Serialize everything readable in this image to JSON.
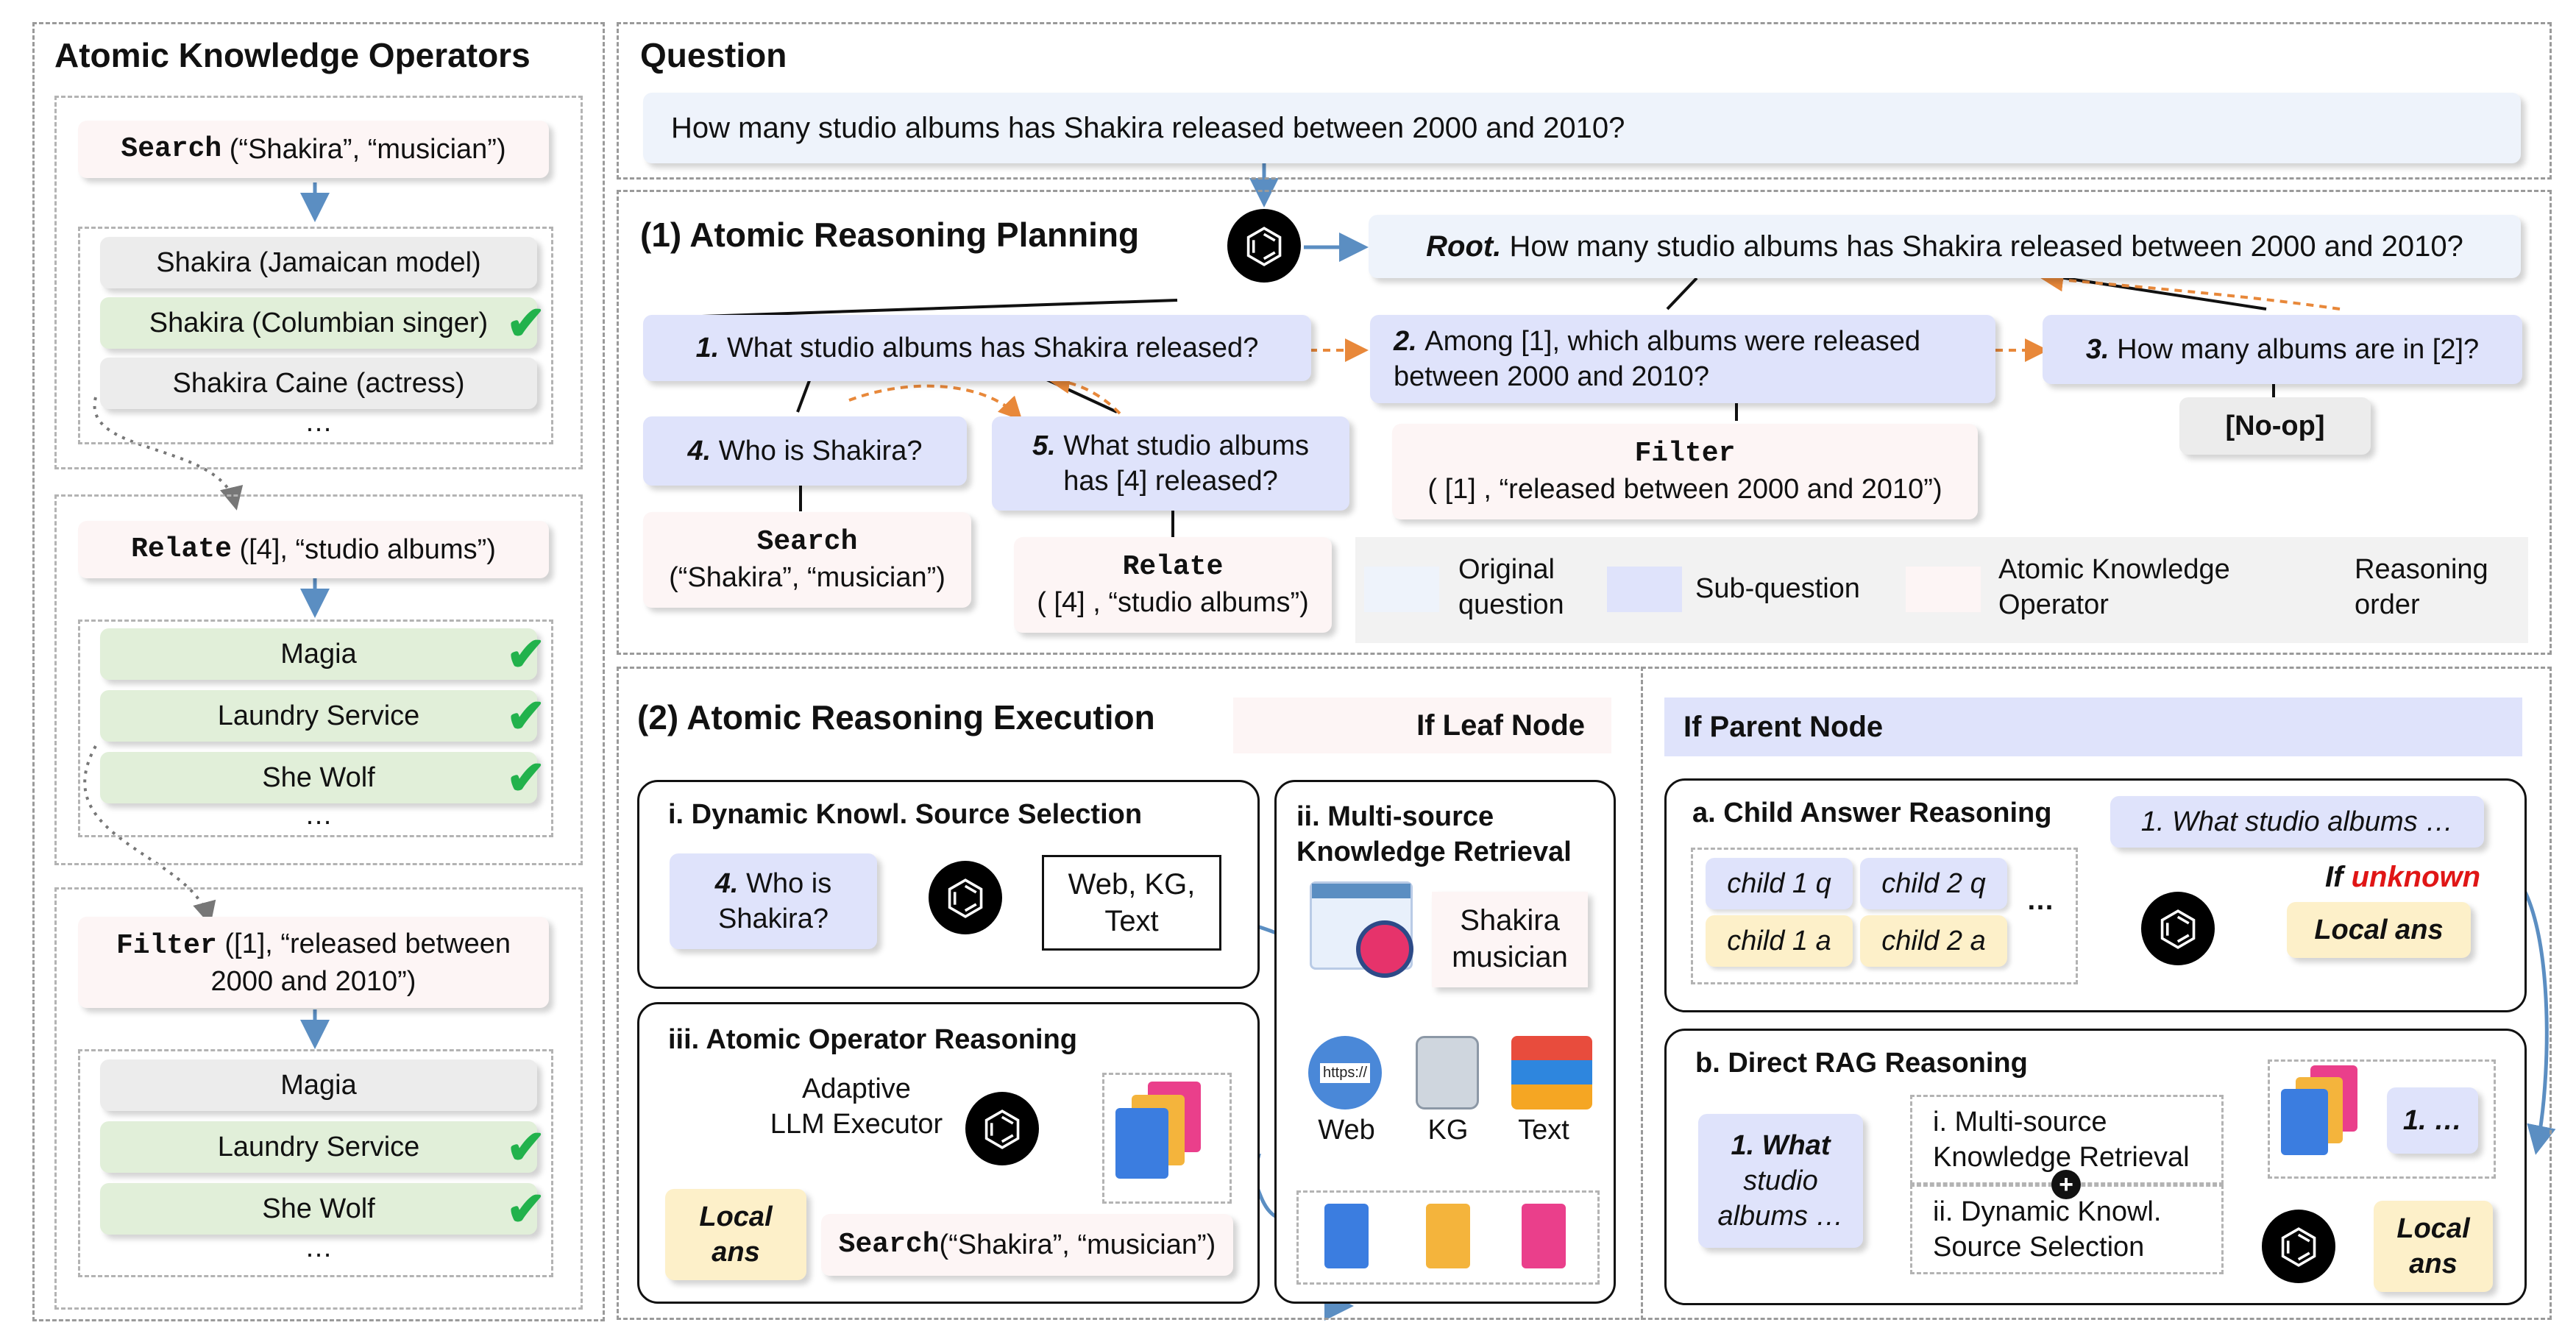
{
  "left": {
    "title": "Atomic Knowledge Operators",
    "search_op": {
      "name": "Search",
      "args": "(“Shakira”, “musician”)"
    },
    "search_results": [
      "Shakira (Jamaican model)",
      "Shakira (Columbian singer)",
      "Shakira Caine (actress)",
      "…"
    ],
    "relate_op": {
      "name": "Relate",
      "args": "([4], “studio albums”)"
    },
    "relate_results": [
      "Magia",
      "Laundry Service",
      "She Wolf",
      "…"
    ],
    "filter_op": {
      "name": "Filter",
      "args_l1": "([1], “released between",
      "args_l2": "2000 and 2010”)"
    },
    "filter_results": [
      "Magia",
      "Laundry Service",
      "She Wolf",
      "…"
    ]
  },
  "question": {
    "title": "Question",
    "text": "How many studio albums has Shakira released between 2000 and 2010?"
  },
  "planning": {
    "title": "(1) Atomic Reasoning Planning",
    "root_label": "Root.",
    "root_text": "How many studio albums has Shakira released between 2000 and 2010?",
    "q1_num": "1.",
    "q1_text": "What studio albums has Shakira released?",
    "q2_num": "2.",
    "q2_text_l1": "Among [1], which albums were released",
    "q2_text_l2": "between 2000 and 2010?",
    "q3_num": "3.",
    "q3_text": "How many albums are in [2]?",
    "q4_num": "4.",
    "q4_text": "Who is Shakira?",
    "q5_num": "5.",
    "q5_text_l1": "What studio albums",
    "q5_text_l2": "has [4] released?",
    "noop": "[No-op]",
    "filter_name": "Filter",
    "filter_args": "( [1] , “released between 2000 and 2010”)",
    "search_name": "Search",
    "search_args": "(“Shakira”, “musician”)",
    "relate_name": "Relate",
    "relate_args": "( [4] , “studio albums”)",
    "legend": {
      "original_l1": "Original",
      "original_l2": "question",
      "subq": "Sub-question",
      "operator_l1": "Atomic Knowledge",
      "operator_l2": "Operator",
      "order_l1": "Reasoning",
      "order_l2": "order"
    }
  },
  "execution": {
    "title": "(2) Atomic Reasoning Execution",
    "leaf_label": "If Leaf Node",
    "parent_label": "If Parent Node",
    "dyn": {
      "title": "i. Dynamic Knowl. Source Selection",
      "q_num": "4.",
      "q_l1": "Who is",
      "q_l2": "Shakira?",
      "sources_l1": "Web, KG,",
      "sources_l2": "Text"
    },
    "multi": {
      "title_l1": "ii. Multi-source",
      "title_l2": "Knowledge Retrieval",
      "query_l1": "Shakira",
      "query_l2": "musician",
      "web": "Web",
      "kg": "KG",
      "text": "Text",
      "https": "https://"
    },
    "atomic": {
      "title": "iii. Atomic Operator Reasoning",
      "exec_l1": "Adaptive",
      "exec_l2": "LLM Executor",
      "local_l1": "Local",
      "local_l2": "ans",
      "search_name": "Search",
      "search_args": "(“Shakira”, “musician”)"
    },
    "child": {
      "title": "a. Child Answer Reasoning",
      "q": "1. What studio albums …",
      "c1q": "child 1 q",
      "c2q": "child 2 q",
      "c1a": "child 1 a",
      "c2a": "child 2 a",
      "dots": "…",
      "if": "If",
      "unknown": "unknown",
      "local": "Local ans"
    },
    "rag": {
      "title": "b. Direct RAG Reasoning",
      "q_l1": "1. What",
      "q_l2": "studio",
      "q_l3": "albums …",
      "m_l1": "i. Multi-source",
      "m_l2": "Knowledge Retrieval",
      "d_l1": "ii. Dynamic Knowl.",
      "d_l2": "Source Selection",
      "ref": "1. …",
      "local_l1": "Local",
      "local_l2": "ans"
    }
  },
  "colors": {
    "arrow_blue": "#5b8ec2",
    "order_orange": "#e8883a",
    "check_green": "#22b24c",
    "unknown_red": "#e01616"
  }
}
